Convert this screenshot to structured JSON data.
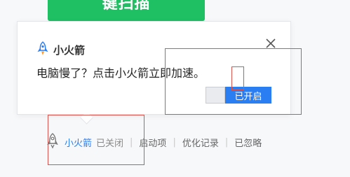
{
  "scan_button": {
    "label": "键扫描"
  },
  "popup": {
    "title": "小火箭",
    "message": "电脑慢了？点击小火箭立即加速。",
    "toggle_label": "已开启",
    "icon": "rocket-icon",
    "close_icon": "close-icon"
  },
  "status_bar": {
    "icon": "rocket-icon",
    "name": "小火箭",
    "state": "已关闭",
    "links": [
      "启动项",
      "优化记录",
      "已忽略"
    ],
    "separator": "|"
  },
  "colors": {
    "green": "#1fbf64",
    "blue": "#2b7ef2",
    "highlight": "#d9534f"
  }
}
